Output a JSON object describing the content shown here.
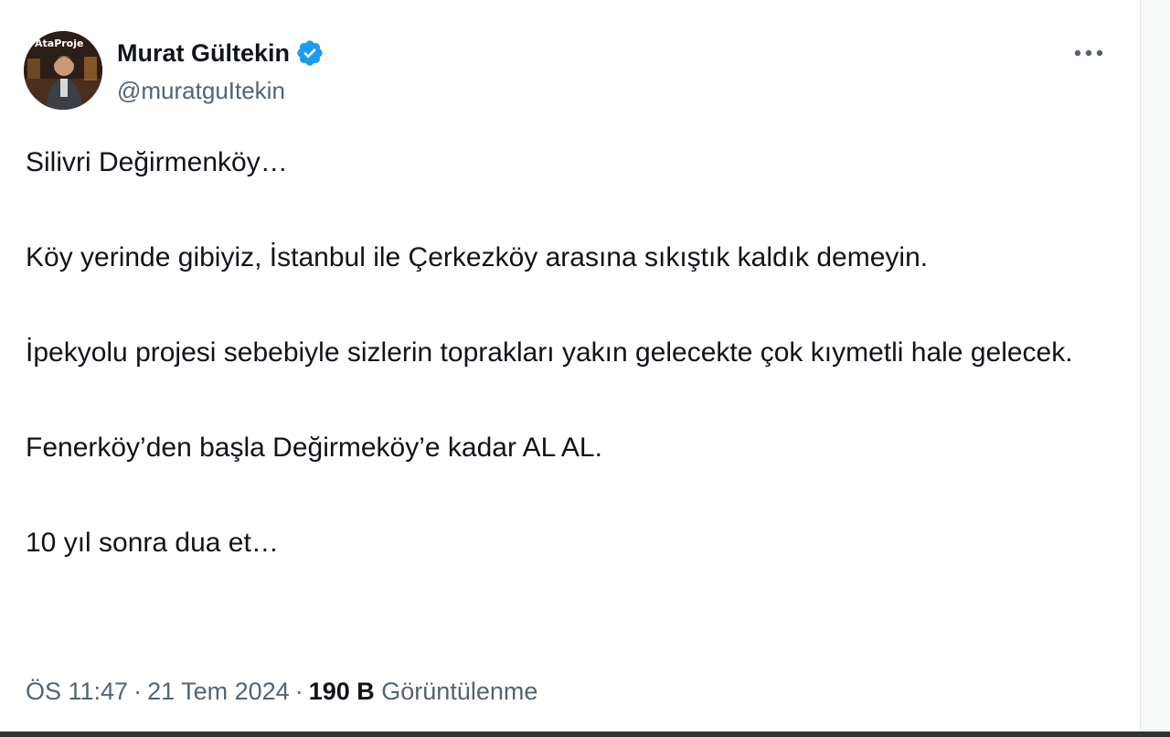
{
  "author": {
    "display_name": "Murat Gültekin",
    "username": "@muratguItekin",
    "verified": true,
    "avatar_text": "AtaProje",
    "badge_color": "#1d9bf0"
  },
  "tweet": {
    "paragraphs": [
      "Silivri Değirmenköy…",
      "Köy yerinde gibiyiz, İstanbul ile Çerkezköy arasına sıkıştık kaldık demeyin.",
      "İpekyolu projesi sebebiyle sizlerin toprakları yakın gelecekte çok kıymetli hale gelecek.",
      "Fenerköy’den başla Değirmeköy’e kadar AL AL.",
      "10 yıl sonra dua et…"
    ]
  },
  "meta": {
    "time": "ÖS 11:47",
    "separator": "·",
    "date": "21 Tem 2024",
    "views_count": "190 B",
    "views_label": "Görüntülenme"
  },
  "icons": {
    "more": "more-horizontal-icon",
    "verified": "verified-badge-icon"
  }
}
